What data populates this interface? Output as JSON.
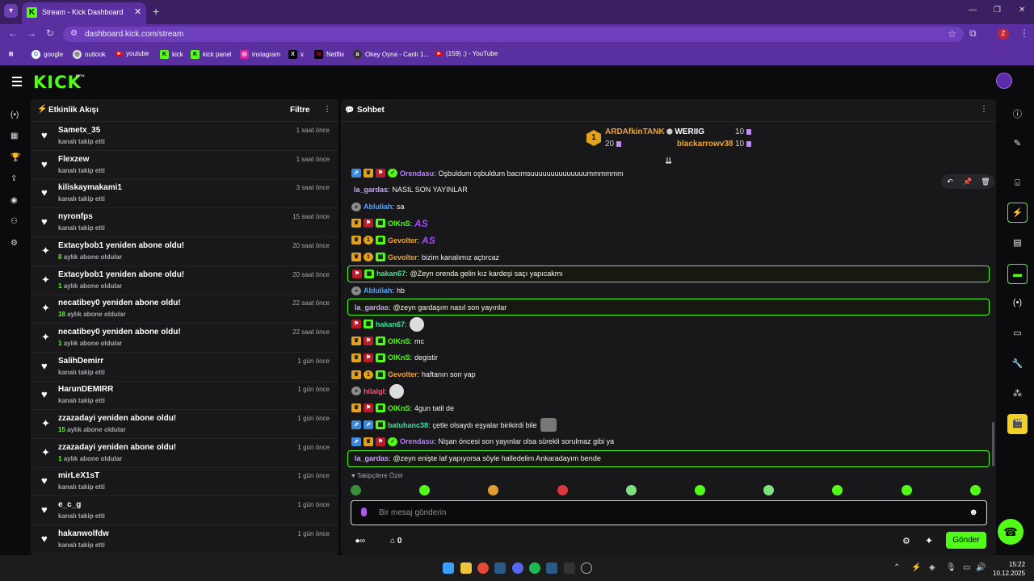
{
  "browser": {
    "tab_title": "Stream - Kick Dashboard",
    "url": "dashboard.kick.com/stream",
    "profile_initial": "Z",
    "bookmarks": [
      "google",
      "outlook",
      "youtube",
      "kick",
      "kick panel",
      "instagram",
      "x",
      "Netflix",
      "Okey Oyna - Canlı 1...",
      "(159) ;) - YouTube"
    ]
  },
  "app": {
    "logo": "KICK",
    "logo_badge": "BETA"
  },
  "activity": {
    "title": "Etkinlik Akışı",
    "filter_label": "Filtre",
    "items": [
      {
        "name": "Sametx_35",
        "sub": "kanalı takip etti",
        "time": "1 saat önce",
        "icon": "heart"
      },
      {
        "name": "Flexzew",
        "sub": "kanalı takip etti",
        "time": "1 saat önce",
        "icon": "heart"
      },
      {
        "name": "kiliskaymakami1",
        "sub": "kanalı takip etti",
        "time": "3 saat önce",
        "icon": "heart"
      },
      {
        "name": "nyronfps",
        "sub": "kanalı takip etti",
        "time": "15 saat önce",
        "icon": "heart"
      },
      {
        "name": "Extacybob1 yeniden abone oldu!",
        "num": "8",
        "sub": "aylık abone oldular",
        "time": "20 saat önce",
        "icon": "sparkle"
      },
      {
        "name": "Extacybob1 yeniden abone oldu!",
        "num": "1",
        "sub": "aylık abone oldular",
        "time": "20 saat önce",
        "icon": "sparkle"
      },
      {
        "name": "necatibey0 yeniden abone oldu!",
        "num": "18",
        "sub": "aylık abone oldular",
        "time": "22 saat önce",
        "icon": "sparkle"
      },
      {
        "name": "necatibey0 yeniden abone oldu!",
        "num": "1",
        "sub": "aylık abone oldular",
        "time": "22 saat önce",
        "icon": "sparkle"
      },
      {
        "name": "SalihDemirr",
        "sub": "kanalı takip etti",
        "time": "1 gün önce",
        "icon": "heart"
      },
      {
        "name": "HarunDEMIRR",
        "sub": "kanalı takip etti",
        "time": "1 gün önce",
        "icon": "heart"
      },
      {
        "name": "zzazadayi yeniden abone oldu!",
        "num": "15",
        "sub": "aylık abone oldular",
        "time": "1 gün önce",
        "icon": "sparkle"
      },
      {
        "name": "zzazadayi yeniden abone oldu!",
        "num": "1",
        "sub": "aylık abone oldular",
        "time": "1 gün önce",
        "icon": "sparkle"
      },
      {
        "name": "mirLeX1sT",
        "sub": "kanalı takip etti",
        "time": "1 gün önce",
        "icon": "heart"
      },
      {
        "name": "e_c_g",
        "sub": "kanalı takip etti",
        "time": "1 gün önce",
        "icon": "heart"
      },
      {
        "name": "hakanwolfdw",
        "sub": "kanalı takip etti",
        "time": "1 gün önce",
        "icon": "heart"
      }
    ]
  },
  "chat": {
    "title": "Sohbet",
    "leaderboard": {
      "first_rank": "1",
      "first_name": "ARDAfkinTANK",
      "first_value": "20",
      "second_name": "WERIIG",
      "second_value": "10",
      "third_name": "blackarrowv38",
      "third_value": "10"
    },
    "messages": [
      {
        "user": "Orendasu",
        "color": "#b87cff",
        "badges": [
          "blue",
          "crown",
          "red",
          "green"
        ],
        "text": "Oşbuldum oşbuldum bacımsuuuuuuuuuuuuuummmmmm",
        "hl": false
      },
      {
        "user": "la_gardas",
        "color": "#c9a5ff",
        "badges": [],
        "text": "NASIL SON YAYINLAR",
        "hl": false
      },
      {
        "user": "Abluliah",
        "color": "#4fa3ff",
        "badges": [
          "cat"
        ],
        "text": "sa",
        "hl": false
      },
      {
        "user": "OlKnS",
        "color": "#53fc18",
        "badges": [
          "crown",
          "red",
          "gift"
        ],
        "text": "",
        "emote": "AS",
        "hl": false
      },
      {
        "user": "Gevolter",
        "color": "#f0a532",
        "badges": [
          "crown",
          "gold",
          "gift"
        ],
        "text": "",
        "emote": "AS",
        "hl": false
      },
      {
        "user": "Gevolter",
        "color": "#f0a532",
        "badges": [
          "crown",
          "gold",
          "gift"
        ],
        "text": "bizim kanalımız açtırcaz",
        "hl": false
      },
      {
        "user": "hakan67",
        "color": "#3fe0a0",
        "badges": [
          "red",
          "gift"
        ],
        "text": "@Zeyn orenda gelin kız kardeşi saçı yapıcakmı",
        "hl": true
      },
      {
        "user": "Abluliah",
        "color": "#4fa3ff",
        "badges": [
          "cat"
        ],
        "text": "hb",
        "hl": false
      },
      {
        "user": "la_gardas",
        "color": "#c9a5ff",
        "badges": [],
        "text": "@zeyn gardaşım nasıl son yayınlar",
        "hl": true
      },
      {
        "user": "hakan67",
        "color": "#3fe0a0",
        "badges": [
          "red",
          "gift"
        ],
        "text": "",
        "emote_img": true,
        "hl": false
      },
      {
        "user": "OlKnS",
        "color": "#53fc18",
        "badges": [
          "crown",
          "red",
          "gift"
        ],
        "text": "mc",
        "hl": false
      },
      {
        "user": "OlKnS",
        "color": "#53fc18",
        "badges": [
          "crown",
          "red",
          "gift"
        ],
        "text": "degistir",
        "hl": false
      },
      {
        "user": "Gevolter",
        "color": "#f0a532",
        "badges": [
          "crown",
          "gold",
          "gift"
        ],
        "text": "haftanın son yap",
        "hl": false
      },
      {
        "user": "hilalgl",
        "color": "#ff4f7b",
        "badges": [
          "cat"
        ],
        "text": "",
        "emote_img": true,
        "hl": false
      },
      {
        "user": "OlKnS",
        "color": "#53fc18",
        "badges": [
          "crown",
          "red",
          "gift"
        ],
        "text": "4gun tatil de",
        "hl": false
      },
      {
        "user": "batuhanc38",
        "color": "#3fe0a0",
        "badges": [
          "blue",
          "blue",
          "gift"
        ],
        "text": "çetle olsaydı eşyalar birikirdi bile",
        "emote_img_after": true,
        "hl": false
      },
      {
        "user": "Orendasu",
        "color": "#b87cff",
        "badges": [
          "blue",
          "crown",
          "red",
          "green"
        ],
        "text": "Nişan öncesi son yayınlar olsa sürekli sorulmaz gibi ya",
        "hl": false
      },
      {
        "user": "la_gardas",
        "color": "#c9a5ff",
        "badges": [],
        "text": "@zeyn enişte laf yapıyorsa söyle halledelim Ankaradayım bende",
        "hl": true
      }
    ],
    "favorites_label": "Takipçilere Özel",
    "input_placeholder": "Bir mesaj gönderin",
    "stream_count": "0",
    "send_label": "Gönder"
  },
  "taskbar": {
    "time": "15:22",
    "date": "10.12.2025"
  }
}
